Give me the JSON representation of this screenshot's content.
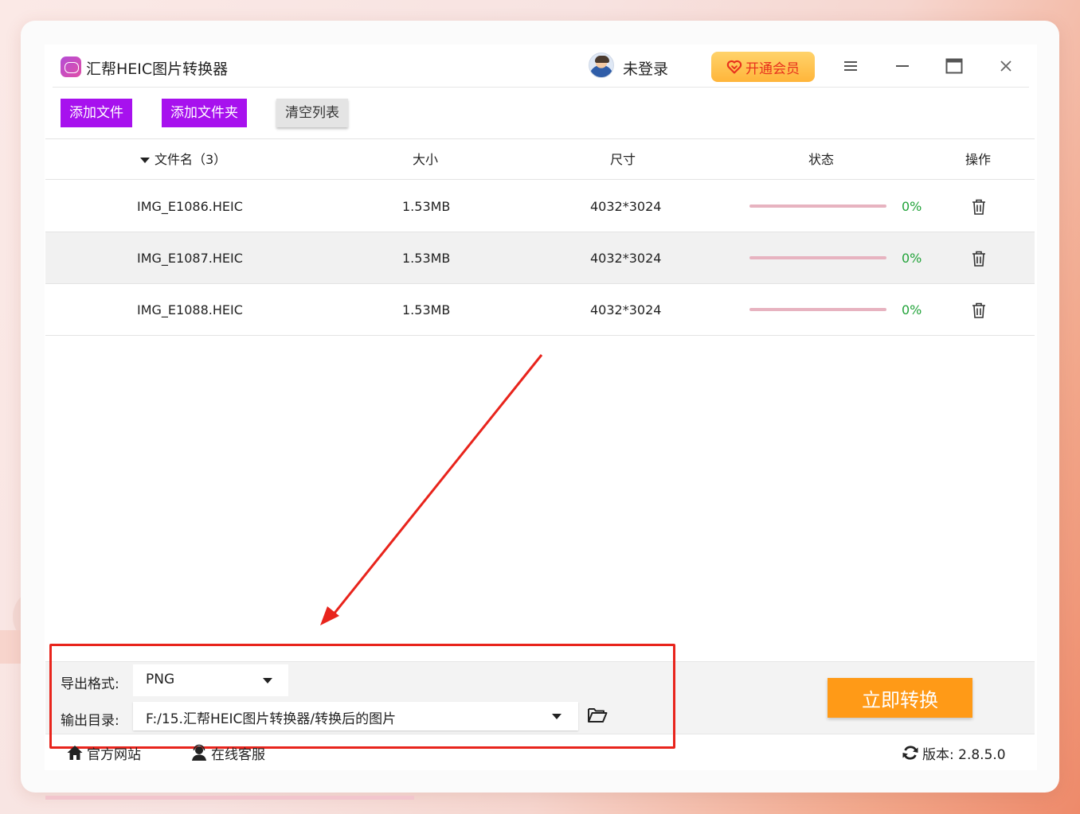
{
  "app": {
    "title": "汇帮HEIC图片转换器",
    "user_status": "未登录",
    "vip_label": "开通会员"
  },
  "toolbar": {
    "add_file": "添加文件",
    "add_folder": "添加文件夹",
    "clear_list": "清空列表"
  },
  "table": {
    "headers": {
      "name": "文件名（3）",
      "size": "大小",
      "dimensions": "尺寸",
      "status": "状态",
      "action": "操作"
    },
    "rows": [
      {
        "name": "IMG_E1086.HEIC",
        "size": "1.53MB",
        "dimensions": "4032*3024",
        "progress": 0,
        "percent": "0%"
      },
      {
        "name": "IMG_E1087.HEIC",
        "size": "1.53MB",
        "dimensions": "4032*3024",
        "progress": 0,
        "percent": "0%"
      },
      {
        "name": "IMG_E1088.HEIC",
        "size": "1.53MB",
        "dimensions": "4032*3024",
        "progress": 0,
        "percent": "0%"
      }
    ]
  },
  "output": {
    "format_label": "导出格式:",
    "format_value": "PNG",
    "dir_label": "输出目录:",
    "dir_value": "F:/15.汇帮HEIC图片转换器/转换后的图片"
  },
  "convert_button": "立即转换",
  "footer": {
    "website": "官方网站",
    "support": "在线客服",
    "version": "版本: 2.8.5.0"
  },
  "colors": {
    "accent_purple": "#a711ee",
    "convert_orange": "#ff9a17",
    "progress_green": "#22a33a",
    "annotation_red": "#e8241c"
  },
  "icons": [
    "app-logo",
    "avatar",
    "heart-icon",
    "menu-icon",
    "minimize-icon",
    "maximize-icon",
    "close-icon",
    "sort-caret-icon",
    "trash-icon",
    "dropdown-icon",
    "folder-icon",
    "home-icon",
    "support-icon",
    "refresh-icon"
  ]
}
